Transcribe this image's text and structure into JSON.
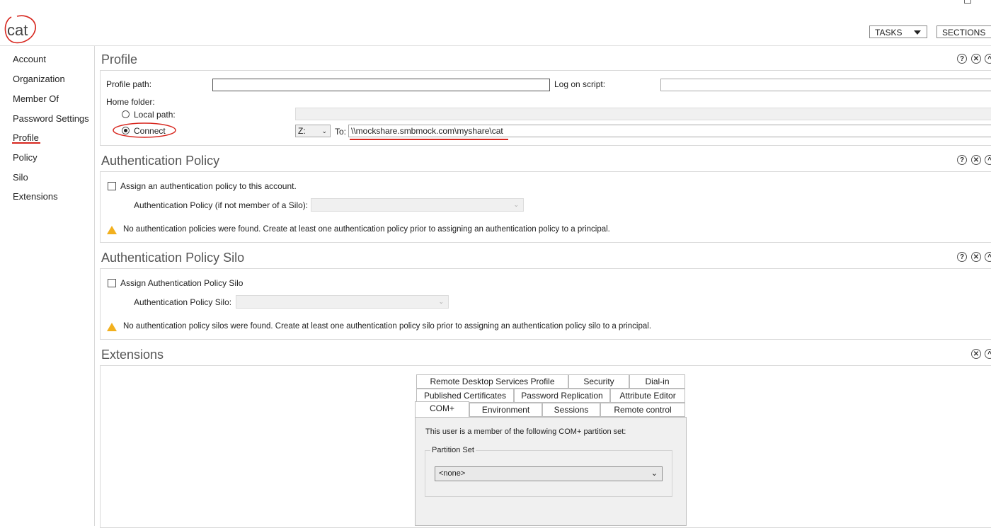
{
  "header": {
    "title": "cat",
    "tasks_label": "TASKS",
    "sections_label": "SECTIONS"
  },
  "sidebar": {
    "items": [
      {
        "label": "Account"
      },
      {
        "label": "Organization"
      },
      {
        "label": "Member Of"
      },
      {
        "label": "Password Settings"
      },
      {
        "label": "Profile"
      },
      {
        "label": "Policy"
      },
      {
        "label": "Silo"
      },
      {
        "label": "Extensions"
      }
    ],
    "active": "Profile"
  },
  "profile": {
    "title": "Profile",
    "profile_path_label": "Profile path:",
    "profile_path_value": "",
    "logon_script_label": "Log on script:",
    "logon_script_value": "",
    "home_folder_label": "Home folder:",
    "local_path_label": "Local path:",
    "connect_label": "Connect",
    "drive_value": "Z:",
    "to_label": "To:",
    "to_value": "\\\\mockshare.smbmock.com\\myshare\\cat"
  },
  "auth_policy": {
    "title": "Authentication Policy",
    "checkbox_label": "Assign an authentication policy to this account.",
    "policy_label": "Authentication Policy (if not member of a Silo):",
    "warning": "No authentication policies were found. Create at least one authentication policy prior to assigning an authentication policy to a principal."
  },
  "auth_silo": {
    "title": "Authentication Policy Silo",
    "checkbox_label": "Assign Authentication Policy Silo",
    "silo_label": "Authentication Policy Silo:",
    "warning": "No authentication policy silos were found. Create at least one authentication policy silo prior to assigning an authentication policy silo to a principal."
  },
  "extensions": {
    "title": "Extensions",
    "tabs_row1": [
      "Remote Desktop Services Profile",
      "Security",
      "Dial-in"
    ],
    "tabs_row2": [
      "Published Certificates",
      "Password Replication",
      "Attribute Editor"
    ],
    "tabs_row3": [
      "COM+",
      "Environment",
      "Sessions",
      "Remote control"
    ],
    "active_tab": "COM+",
    "com_text": "This user is a member of the following COM+ partition set:",
    "partition_label": "Partition Set",
    "partition_value": "<none>"
  },
  "icons": {
    "help": "?",
    "close": "✕",
    "collapse": "^"
  },
  "colors": {
    "annotation_red": "#d7261e",
    "warning_yellow": "#f2b01e"
  }
}
